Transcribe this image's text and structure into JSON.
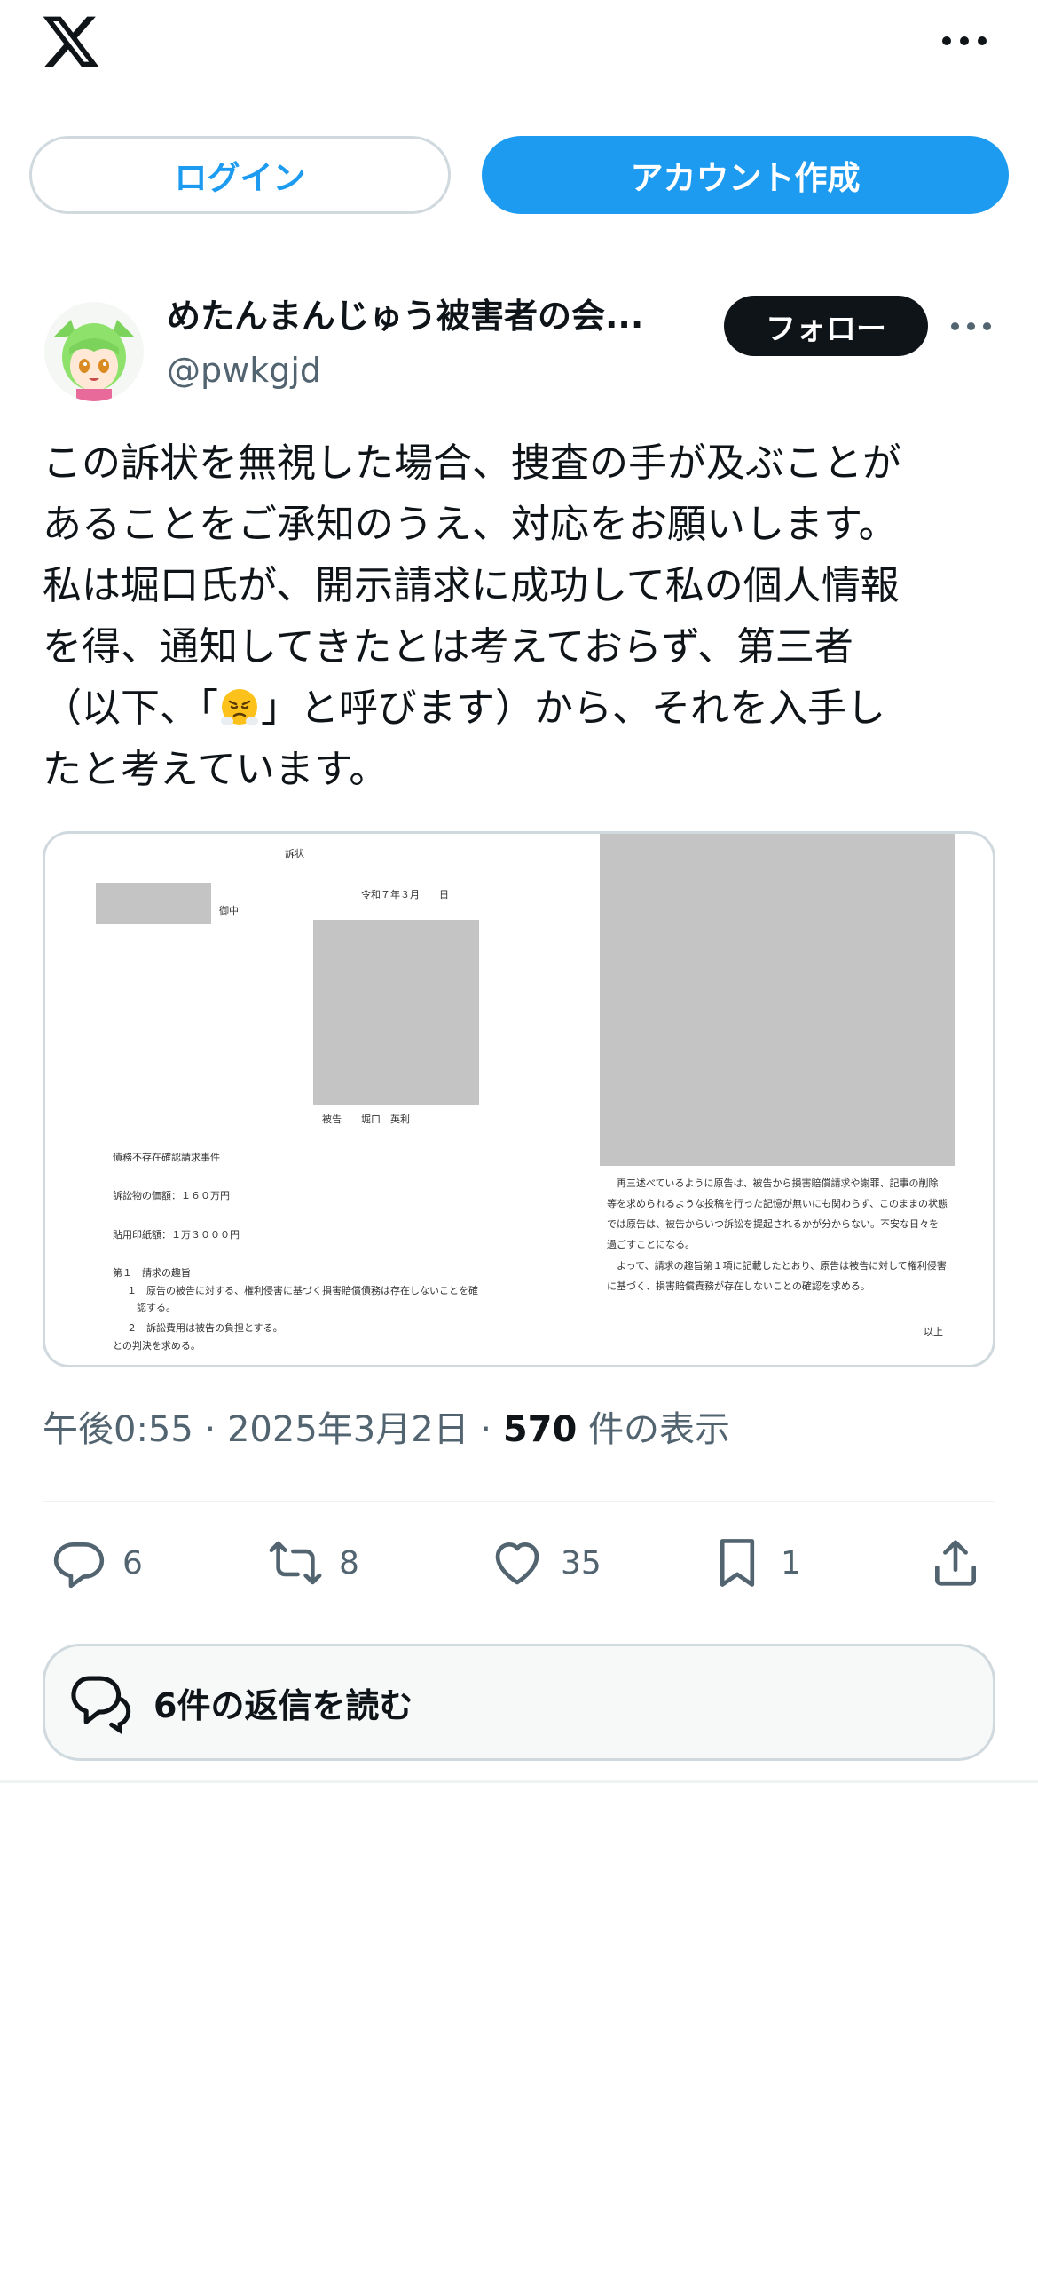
{
  "header": {
    "logo_icon": "x-logo-icon",
    "more_icon": "more-horizontal-icon",
    "login_label": "ログイン",
    "signup_label": "アカウント作成"
  },
  "tweet": {
    "author": {
      "display_name": "めたんまんじゅう被害者の会...",
      "handle": "@pwkgjd",
      "avatar_icon": "avatar-green-hair-character"
    },
    "follow_label": "フォロー",
    "text_lines": [
      "この訴状を無視した場合、捜査の手が及ぶことが",
      "あることをご承知のうえ、対応をお願いします。",
      "私は堀口氏が、開示請求に成功して私の個人情報",
      "を得、通知してきたとは考えておらず、第三者",
      "（以下、「",
      "」と呼びます）から、それを入手し",
      "たと考えています。"
    ],
    "text_emoji": "face-with-steam-from-nose-emoji",
    "media": {
      "page1": {
        "title": "訴状",
        "date": "令和７年３月　　日",
        "addressee_suffix": "御中",
        "defendant": "被告　　堀口　英利",
        "case_name": "債務不存在確認請求事件",
        "claim_value": "訴訟物の価額：１６０万円",
        "stamp_fee": "貼用印紙額：１万３０００円",
        "section1": "第１　請求の趣旨",
        "item1_a": "１　原告の被告に対する、権利侵害に基づく損害賠償債務は存在しないことを確",
        "item1_b": "　認する。",
        "item2": "２　訴訟費用は被告の負担とする。",
        "judgment": "との判決を求める。"
      },
      "page2": {
        "line1": "　再三述べているように原告は、被告から損害賠償請求や謝罪、記事の削除",
        "line2": "等を求められるような投稿を行った記憶が無いにも関わらず、このままの状態",
        "line3": "では原告は、被告からいつ訴訟を提起されるかが分からない。不安な日々を",
        "line4": "過ごすことになる。",
        "line5": "　よって、請求の趣旨第１項に記載したとおり、原告は被告に対して権利侵害",
        "line6": "に基づく、損害賠償責務が存在しないことの確認を求める。",
        "closing": "以上"
      }
    },
    "time": "午後0:55",
    "date": "2025年3月2日",
    "views_count": "570",
    "views_label": "件の表示",
    "separator": "·",
    "actions": {
      "reply_count": "6",
      "retweet_count": "8",
      "like_count": "35",
      "bookmark_count": "1"
    },
    "read_replies_label": "6件の返信を読む"
  },
  "colors": {
    "accent": "#1d9bf0",
    "text": "#0f1419",
    "secondary": "#536471",
    "border": "#cfd9de"
  }
}
